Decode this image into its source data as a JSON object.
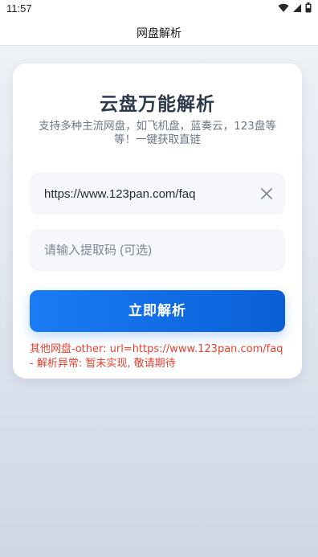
{
  "status_bar": {
    "time": "11:57",
    "icons": [
      "wifi-icon",
      "signal-icon",
      "battery-icon"
    ]
  },
  "app_bar": {
    "title": "网盘解析"
  },
  "card": {
    "title": "云盘万能解析",
    "subtitle": "支持多种主流网盘，如飞机盘，蓝奏云，123盘等等！一键获取直链",
    "url_input": {
      "value": "https://www.123pan.com/faq",
      "placeholder": ""
    },
    "code_input": {
      "value": "",
      "placeholder": "请输入提取码 (可选)"
    },
    "submit_label": "立即解析",
    "error_message": "其他网盘-other: url=https://www.123pan.com/faq - 解析异常: 暂未实现, 敬请期待"
  },
  "colors": {
    "accent": "#1a7cf5",
    "error": "#e5412f",
    "title": "#2d3a4b"
  }
}
